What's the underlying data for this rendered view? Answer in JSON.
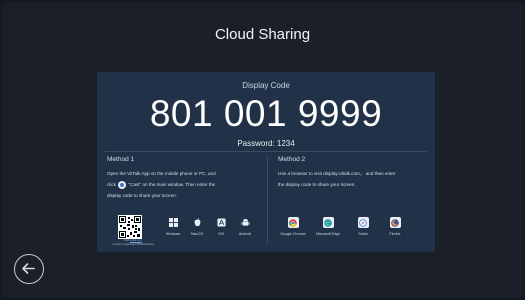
{
  "page": {
    "title": "Cloud Sharing"
  },
  "card": {
    "code_label": "Display Code",
    "code": "801 001 9999",
    "password": "Password: 1234"
  },
  "method1": {
    "title": "Method 1",
    "line1": "Open the ViiTalk App on the mobile phone or PC, and",
    "line2_pre": "click",
    "line2_post": "\"Cast\" on the main window. Then enter the",
    "line3": "display code to share your screen.",
    "cast_icon": "cast-icon",
    "qr_note_pre": "Visit",
    "qr_note_link": "viitalk.com",
    "qr_note_post": "or scan to download ViiTalk Meeting",
    "platforms": [
      {
        "label": "Windows",
        "icon": "windows-icon"
      },
      {
        "label": "MacOS",
        "icon": "apple-icon"
      },
      {
        "label": "iOS",
        "icon": "ios-app-icon"
      },
      {
        "label": "Android",
        "icon": "android-icon"
      }
    ]
  },
  "method2": {
    "title": "Method 2",
    "line1": "Use a browser to visit display.viitalk.com， and then enter",
    "line2": "the display code to share your screen.",
    "browsers": [
      {
        "label": "Google Chrome",
        "icon": "chrome-icon",
        "color": "#e0453a"
      },
      {
        "label": "Microsoft Edge",
        "icon": "edge-icon",
        "color": "#1f8fb8"
      },
      {
        "label": "Safari",
        "icon": "safari-icon",
        "color": "#2f7fe0"
      },
      {
        "label": "Firefox",
        "icon": "firefox-icon",
        "color": "#3a4e9c"
      }
    ]
  },
  "footer": {
    "back_icon": "back-arrow-icon"
  },
  "colors": {
    "background": "#1b1f27",
    "card": "#213248",
    "accent": "#3d7bd9"
  }
}
